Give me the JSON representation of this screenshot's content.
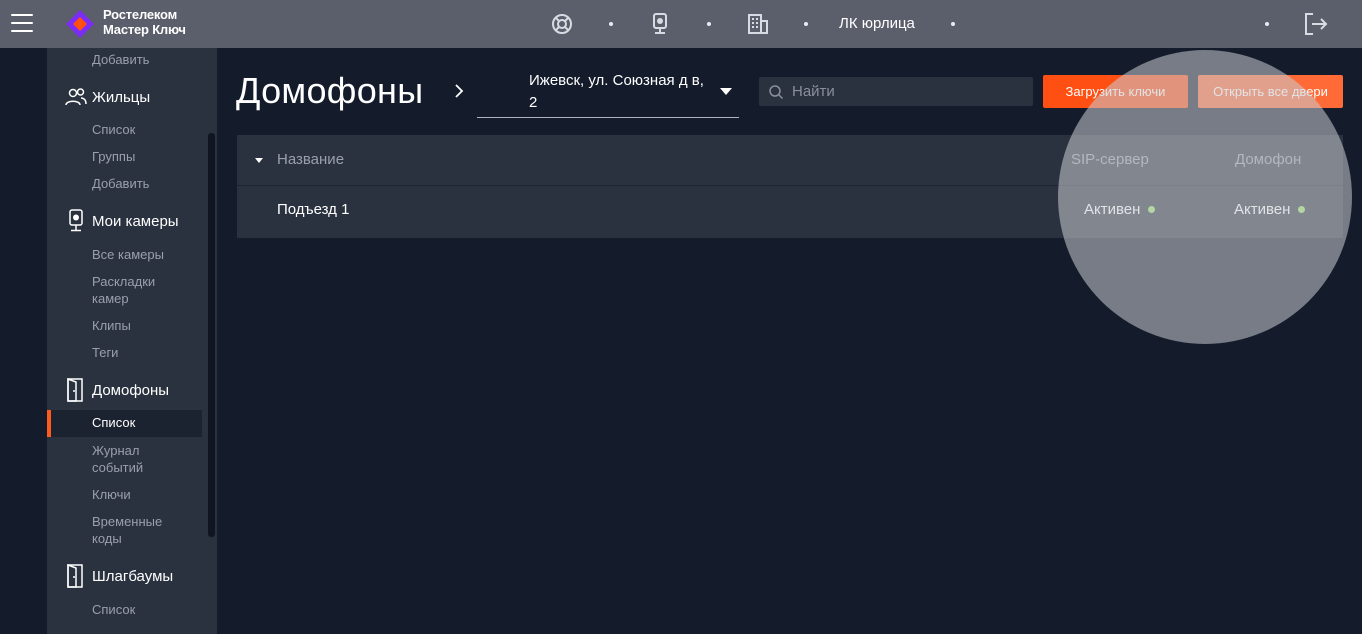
{
  "brand": {
    "line1": "Ростелеком",
    "line2": "Мастер Ключ"
  },
  "topbar": {
    "account_label": "ЛК юрлица"
  },
  "sidebar": {
    "add_top": "Добавить",
    "residents": {
      "title": "Жильцы",
      "items": [
        "Список",
        "Группы",
        "Добавить"
      ]
    },
    "cameras": {
      "title": "Мои камеры",
      "items": [
        "Все камеры",
        "Раскладки камер",
        "Клипы",
        "Теги"
      ]
    },
    "intercoms": {
      "title": "Домофоны",
      "active": "Список",
      "items": [
        "Журнал событий",
        "Ключи",
        "Временные коды"
      ]
    },
    "barriers": {
      "title": "Шлагбаумы",
      "items": [
        "Список"
      ]
    }
  },
  "main": {
    "title": "Домофоны",
    "address": "Ижевск, ул. Союзная д в, 2",
    "search_placeholder": "Найти",
    "upload_keys_label": "Загрузить ключи",
    "open_all_label": "Открыть все двери"
  },
  "table": {
    "columns": [
      "Название",
      "SIP-сервер",
      "Домофон"
    ],
    "rows": [
      {
        "name": "Подъезд 1",
        "sip": "Активен",
        "intercom": "Активен"
      }
    ]
  },
  "colors": {
    "accent": "#ff4f12",
    "status_active": "#9be36a",
    "topbar": "#5a5f6b",
    "sidebar": "#2a313f",
    "background": "#141b2b"
  }
}
